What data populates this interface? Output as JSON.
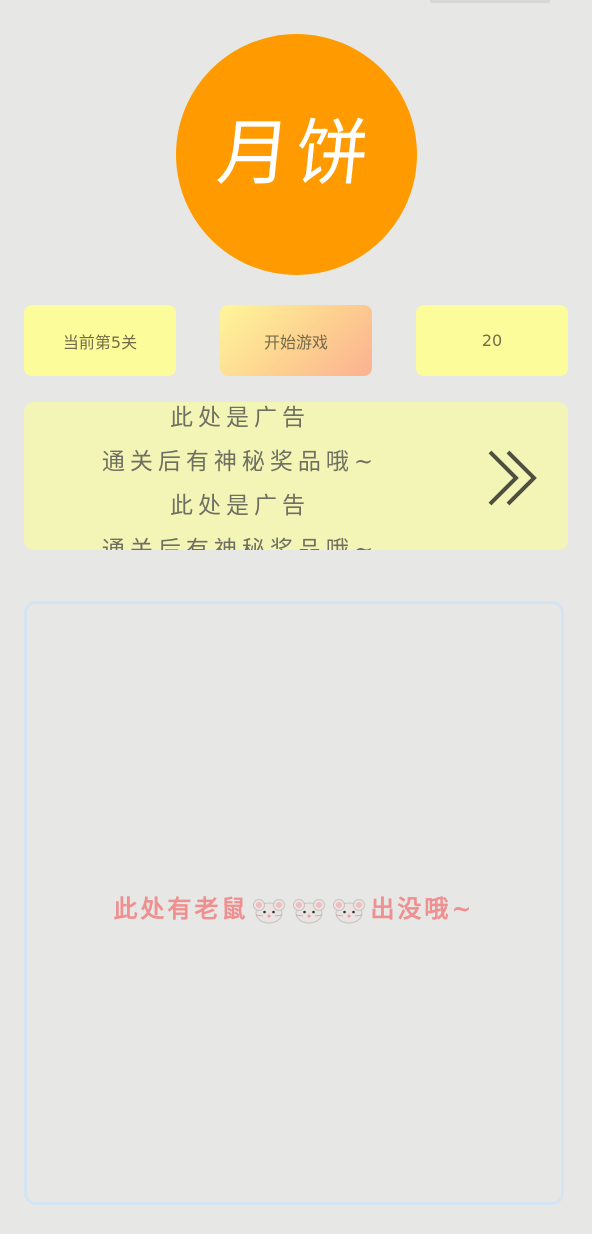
{
  "header": {
    "logo_text": "月饼",
    "logo_color": "#ff9b00"
  },
  "stats": {
    "level_label": "当前第5关",
    "start_label": "开始游戏",
    "score_value": "20"
  },
  "ad": {
    "lines": [
      "此处是广告",
      "通关后有神秘奖品哦~",
      "此处是广告",
      "通关后有神秘奖品哦~"
    ],
    "arrow_icon": "double-chevron-right-icon"
  },
  "board": {
    "message_before": "此处有老鼠",
    "message_after": "出没哦~",
    "mouse_icon": "mouse-icon",
    "mouse_count": 3,
    "message_color": "#ee8f90"
  }
}
